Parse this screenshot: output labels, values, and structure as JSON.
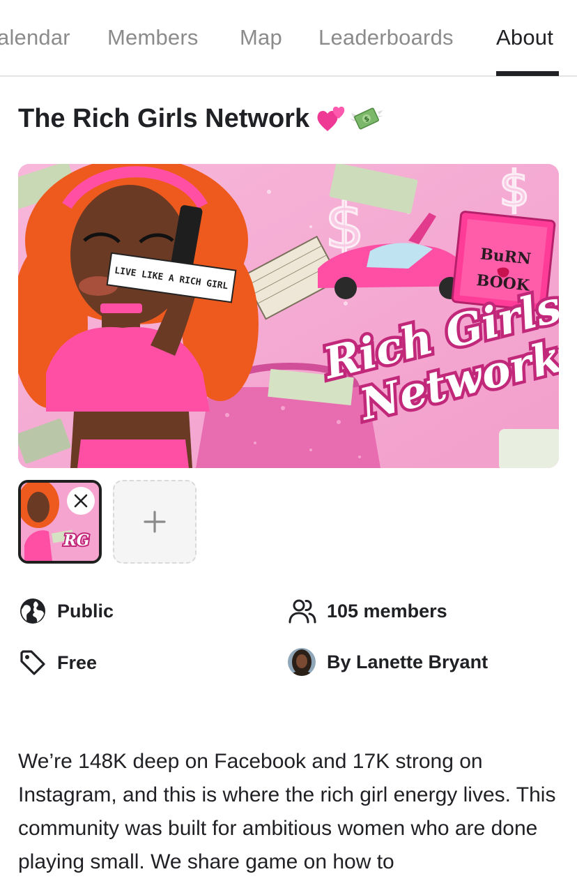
{
  "tabs": [
    {
      "label": "alendar"
    },
    {
      "label": "Members"
    },
    {
      "label": "Map"
    },
    {
      "label": "Leaderboards"
    },
    {
      "label": "About",
      "active": true
    }
  ],
  "group": {
    "title": "The Rich Girls Network",
    "title_emoji": [
      "pink-hearts-icon",
      "money-with-wings-icon"
    ]
  },
  "banner": {
    "speech_bubble": "LIVE LIKE A RICH GIRL",
    "logo_line1": "Rich Girls",
    "logo_line2": "Network",
    "book_title_1": "BuRN",
    "book_title_2": "BOOK"
  },
  "gallery": {
    "add_symbol": "+",
    "remove_symbol": "✕"
  },
  "meta": {
    "privacy": "Public",
    "members": "105 members",
    "price": "Free",
    "owner": "By Lanette Bryant"
  },
  "description": "We’re 148K deep on Facebook and 17K strong on Instagram, and this is where the rich girl energy lives. This community was built for ambitious women who are done playing small. We share game on how to",
  "colors": {
    "accent": "#202124",
    "muted": "#8b8b8b",
    "banner_pink": "#f3a9d2",
    "hot_pink": "#ec3f97"
  }
}
